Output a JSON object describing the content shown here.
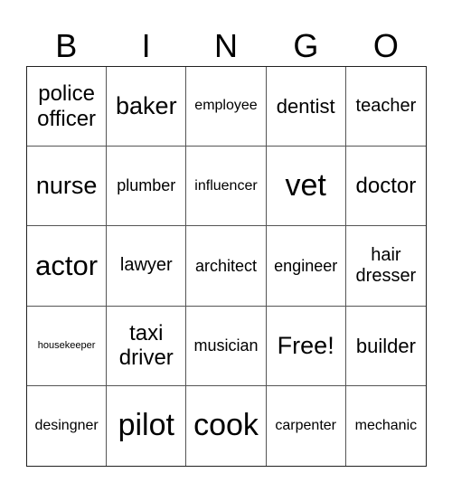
{
  "header": [
    "B",
    "I",
    "N",
    "G",
    "O"
  ],
  "cells": [
    "police officer",
    "baker",
    "employee",
    "dentist",
    "teacher",
    "nurse",
    "plumber",
    "influencer",
    "vet",
    "doctor",
    "actor",
    "lawyer",
    "architect",
    "engineer",
    "hair dresser",
    "housekeeper",
    "taxi driver",
    "musician",
    "Free!",
    "builder",
    "desingner",
    "pilot",
    "cook",
    "carpenter",
    "mechanic"
  ]
}
